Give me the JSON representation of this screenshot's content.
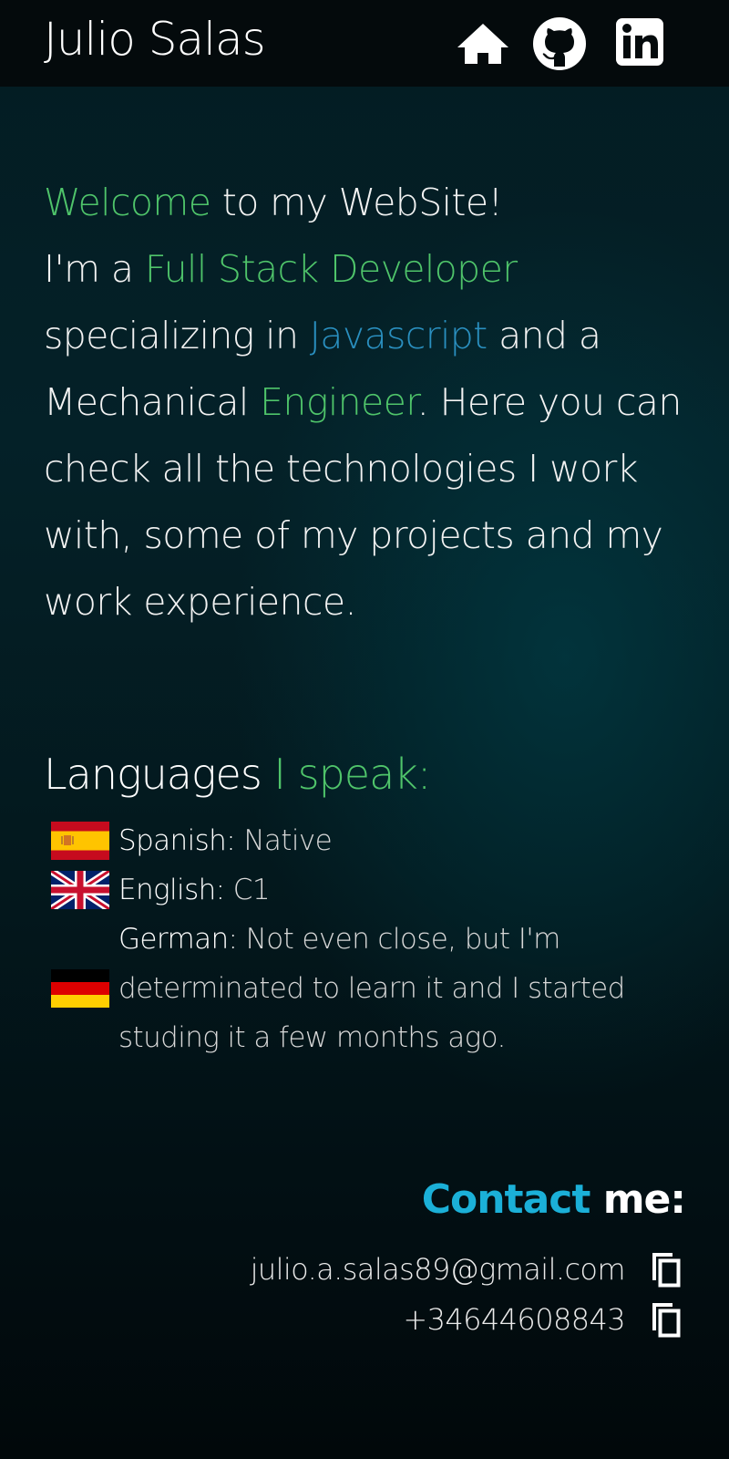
{
  "header": {
    "title": "Julio Salas",
    "nav_icons": [
      "home-icon",
      "github-icon",
      "linkedin-icon"
    ]
  },
  "intro": {
    "heading_part1": "Welcome",
    "heading_part2": " to my WebSite!",
    "t1": "I'm a ",
    "t2": "Full Stack Developer",
    "t3": " specializing in ",
    "t4": "Javascript",
    "t5": " and a Mechanical ",
    "t6": "Engineer",
    "t7": ". Here you can check all the technologies I work with, some of my projects and my work experience."
  },
  "languages": {
    "title_part1": "Languages ",
    "title_part2": "I speak:",
    "items": [
      {
        "flag": "spain-flag",
        "name": "Spanish:",
        "level": " Native"
      },
      {
        "flag": "uk-flag",
        "name": "English:",
        "level": " C1"
      },
      {
        "flag": "germany-flag",
        "name": "German:",
        "level": " Not even close, but I'm determinated to learn it and I started studing it a few months ago."
      }
    ]
  },
  "contact": {
    "title_part1": "Contact",
    "title_part2": " me:",
    "email": "julio.a.salas89@gmail.com",
    "phone": "+34644608843"
  },
  "colors": {
    "green_accent": "#4fc46a",
    "blue_accent": "#2a8fbf",
    "contact_blue": "#1bb0d8",
    "header_bg": "#040a0c"
  }
}
